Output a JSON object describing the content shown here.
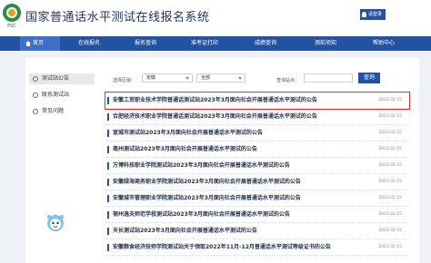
{
  "header": {
    "logo_text": "PSC",
    "site_title": "国家普通话水平测试在线报名系统",
    "user_label": "请登录"
  },
  "nav": {
    "items": [
      "首页",
      "在线报名",
      "报名查询",
      "准考证打印",
      "成绩查询",
      "测前须知",
      "帮助中心"
    ]
  },
  "sidebar": {
    "items": [
      "测试站公告",
      "联系测试站",
      "常见问题"
    ]
  },
  "filter": {
    "region_label": "选择区域：",
    "province_value": "安徽",
    "city_value": "全部",
    "keyword_label": "查询站点：",
    "keyword_value": "",
    "query_button": "查询"
  },
  "notices": [
    {
      "title": "安徽工贸职业技术学院普通话测试站2023年3月面向社会开展普通话水平测试的公告",
      "date": "2023 02 15"
    },
    {
      "title": "合肥经济技术职业学院普通话测试站2023年3月面向社会开展普通话水平测试的公告",
      "date": "2023 02 15"
    },
    {
      "title": "宣城市测试站2023年3月面向社会开展普通话水平测试的公告",
      "date": "2023 02 15"
    },
    {
      "title": "亳州测试站2023年3月面向社会开展普通话水平测试的公告",
      "date": "2023 02 15"
    },
    {
      "title": "万博科技职业学院测试站2023年3月面向社会开展普通话水平测试的公告",
      "date": "2023 02 15"
    },
    {
      "title": "安徽绿海商务职业学院测试站2023年3月面向社会开展普通话水平测试的公告",
      "date": "2023 02 15"
    },
    {
      "title": "安徽城市管理职业学院测试站2023年3月面向社会开展普通话水平测试的公告",
      "date": "2023 02 15"
    },
    {
      "title": "宿州逸夫师范学校测试站2023年3月面向社会开展普通话水平测试的公告",
      "date": "2023 02 15"
    },
    {
      "title": "天长测试站2023年3月面向社会开展普通话水平测试的公告",
      "date": "2023 02 15"
    },
    {
      "title": "安徽粮食经济技师学院测试站关于领取2022年11月-12月普通话水平测试等级证书的公告",
      "date": "2023 02 15"
    }
  ],
  "colors": {
    "brand": "#2452a3",
    "highlight": "#d9302c"
  }
}
